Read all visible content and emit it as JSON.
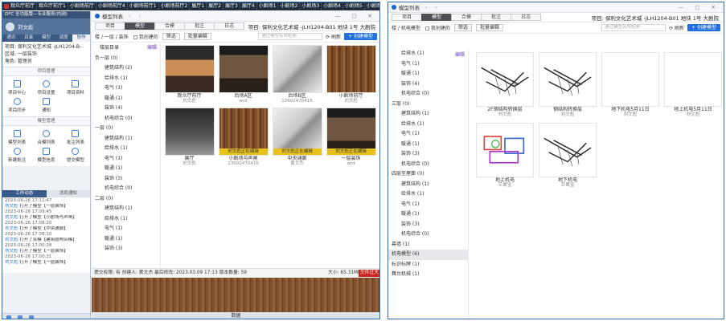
{
  "top_tabs": [
    "观众厅前厅",
    "观众厅前厅1",
    "小剧场前厅",
    "小剧场前厅4",
    "小剧场前厅1",
    "小剧场前厅2",
    "展厅1",
    "展厅2",
    "展厅3",
    "展厅4",
    "小剧场1",
    "小剧场2",
    "小剧场3",
    "小剧场4",
    "小剧场5",
    "小剧场6",
    "小剧场7",
    "小剧场8"
  ],
  "phone": {
    "title": "DFC 全功能版—专业服务(内测)",
    "user": "刘文彪",
    "nav_tabs": [
      "通讯",
      "目录",
      "模型",
      "调度",
      "协作"
    ],
    "project": "项目: 保利文化艺术城 -JLH1204-B-",
    "area": "区域: 一层装饰",
    "role": "角色: 管理员",
    "section1": "项目管理",
    "section1_items": [
      "项目中心",
      "项目设置",
      "项目资料",
      "项目同步",
      "通知"
    ],
    "section2": "模型管理",
    "section2_items": [
      "模型列表",
      "合模列表",
      "批注列表",
      "新建批注",
      "模型信息",
      "提交模型"
    ],
    "activity_tabs": [
      "工作动态",
      "消息通知"
    ],
    "activities": [
      {
        "time": "2023-06-26 17:11:47",
        "user": "刘文彪",
        "text": "打开了模型【一层装饰】"
      },
      {
        "time": "2023-06-26 17:09:45",
        "user": "刘文彪",
        "text": "打开了模型【小剧场与声闸】"
      },
      {
        "time": "2023-06-26 17:08:20",
        "user": "刘文彪",
        "text": "打开了模型【中央通廊】"
      },
      {
        "time": "2023-06-26 17:08:10",
        "user": "刘文彪",
        "text": "打开了合模【建筑结构合模】"
      },
      {
        "time": "2023-06-26 17:00:28",
        "user": "刘文彪",
        "text": "打开了模型【一层装饰】"
      },
      {
        "time": "2023-06-26 17:00:31",
        "user": "刘文彪",
        "text": "打开了模型【一层装饰】"
      }
    ]
  },
  "win_left": {
    "title": "模型列表",
    "tabs": [
      "项目",
      "模型",
      "合模",
      "批注",
      "日志"
    ],
    "project_text": "项目: 保利文化艺术城 -JLH1204-B01 地块 1号 大剧院",
    "breadcrumb": "楼 / 一层 / 装饰",
    "my_created": "我创建的",
    "filter": "筛选",
    "batch_edit": "批量编辑",
    "search_placeholder": "通过模型名称检索",
    "refresh": "刷新",
    "create": "+ 创建模型",
    "tree_header": "楼层目录",
    "edit": "编辑",
    "tree": [
      {
        "label": "负一层 (0)",
        "level": 0
      },
      {
        "label": "建筑结构 (2)",
        "level": 1
      },
      {
        "label": "给排水 (1)",
        "level": 1
      },
      {
        "label": "电气 (1)",
        "level": 1
      },
      {
        "label": "暖通 (1)",
        "level": 1
      },
      {
        "label": "装饰 (4)",
        "level": 1
      },
      {
        "label": "机电综合 (0)",
        "level": 1
      },
      {
        "label": "一层 (0)",
        "level": 0
      },
      {
        "label": "建筑结构 (1)",
        "level": 1
      },
      {
        "label": "给排水 (1)",
        "level": 1
      },
      {
        "label": "电气 (1)",
        "level": 1
      },
      {
        "label": "暖通 (1)",
        "level": 1
      },
      {
        "label": "装饰 (3)",
        "level": 1
      },
      {
        "label": "机电综合 (0)",
        "level": 1
      },
      {
        "label": "二层 (0)",
        "level": 0
      },
      {
        "label": "建筑结构 (1)",
        "level": 1
      },
      {
        "label": "给排水 (1)",
        "level": 1
      },
      {
        "label": "电气 (1)",
        "level": 1
      },
      {
        "label": "暖通 (1)",
        "level": 1
      },
      {
        "label": "装饰 (3)",
        "level": 1
      }
    ],
    "cards": [
      {
        "name": "观众厅前厅",
        "sub": "刘文彪",
        "style": "stage",
        "banner": ""
      },
      {
        "name": "后场A区",
        "sub": "wrd",
        "style": "hall",
        "banner": ""
      },
      {
        "name": "后场B区",
        "sub": "13602470416",
        "style": "gray3d",
        "banner": ""
      },
      {
        "name": "小剧场前厅",
        "sub": "刘文彪",
        "style": "wood",
        "banner": ""
      },
      {
        "name": "展厅",
        "sub": "刘文彪",
        "style": "dark",
        "banner": ""
      },
      {
        "name": "小剧场与声闸",
        "sub": "13602470416",
        "style": "wood",
        "banner": "刘文彪正在编辑"
      },
      {
        "name": "中央通廊",
        "sub": "黄文杰",
        "style": "gray3d",
        "banner": "刘文彪正在编辑"
      },
      {
        "name": "一层装饰",
        "sub": "wrd",
        "style": "hall",
        "banner": "刘文彪正在编辑"
      }
    ],
    "status": "提交权限: 有  创建人: 黄文杰  最后修改: 2023.03.09 17:13  版本数量: 59",
    "size": "大小: 65.31MB",
    "over": "文件过大"
  },
  "shared_label": "数据",
  "win_right": {
    "title": "模型列表",
    "tabs": [
      "项目",
      "模型",
      "合模",
      "批注",
      "日志"
    ],
    "project_text": "项目: 保利文化艺术城 -JLH1204-B01 地块 1号 大剧院",
    "breadcrumb": "楼 / 机电模型",
    "my_created": "我创建的",
    "filter": "筛选",
    "batch_edit": "批量编辑",
    "search_placeholder": "通过模型名称检索",
    "refresh": "刷新",
    "create": "+ 创建模型",
    "edit": "编辑",
    "tree": [
      {
        "label": "给排水 (1)",
        "level": 1
      },
      {
        "label": "电气 (1)",
        "level": 1
      },
      {
        "label": "暖通 (1)",
        "level": 1
      },
      {
        "label": "装饰 (4)",
        "level": 1
      },
      {
        "label": "机电综合 (0)",
        "level": 1
      },
      {
        "label": "三层 (0)",
        "level": 0
      },
      {
        "label": "建筑结构 (1)",
        "level": 1
      },
      {
        "label": "给排水 (1)",
        "level": 1
      },
      {
        "label": "电气 (1)",
        "level": 1
      },
      {
        "label": "暖通 (1)",
        "level": 1
      },
      {
        "label": "装饰 (3)",
        "level": 1
      },
      {
        "label": "机电综合 (0)",
        "level": 1
      },
      {
        "label": "四层至屋面 (0)",
        "level": 0
      },
      {
        "label": "建筑结构 (1)",
        "level": 1
      },
      {
        "label": "给排水 (1)",
        "level": 1
      },
      {
        "label": "电气 (1)",
        "level": 1
      },
      {
        "label": "暖通 (1)",
        "level": 1
      },
      {
        "label": "装饰 (3)",
        "level": 1
      },
      {
        "label": "机电综合 (0)",
        "level": 1
      },
      {
        "label": "幕墙 (1)",
        "level": 0
      },
      {
        "label": "机电模型 (6)",
        "level": 0,
        "selected": true
      },
      {
        "label": "标识标牌 (1)",
        "level": 0
      },
      {
        "label": "舞台机械 (1)",
        "level": 0
      }
    ],
    "cards": [
      {
        "name": "2F钢结构转换层",
        "sub": "刘文彪",
        "style": "line-art"
      },
      {
        "name": "钢结构转换层",
        "sub": "刘文彪",
        "style": "line-art"
      },
      {
        "name": "地下机电5月11日",
        "sub": "刘文彪",
        "style": "blank"
      },
      {
        "name": "地上机电5月11日",
        "sub": "刘文彪",
        "style": "blank"
      },
      {
        "name": "地上机电",
        "sub": "芒果宝",
        "style": "colorful"
      },
      {
        "name": "地下机电",
        "sub": "芒果宝",
        "style": "line-art"
      }
    ]
  }
}
